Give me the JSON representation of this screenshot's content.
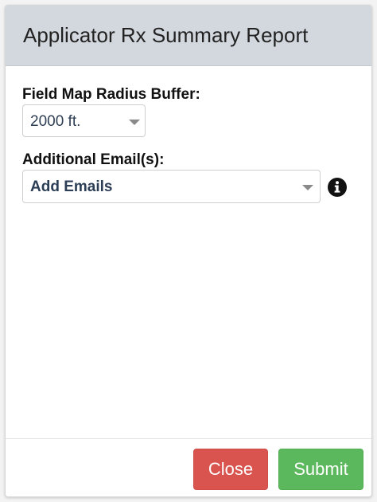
{
  "modal": {
    "title": "Applicator Rx Summary Report"
  },
  "form": {
    "radius_label": "Field Map Radius Buffer:",
    "radius_value": "2000 ft.",
    "emails_label": "Additional Email(s):",
    "emails_value": "Add Emails",
    "info_icon": "info-circle-icon"
  },
  "footer": {
    "close_label": "Close",
    "submit_label": "Submit"
  },
  "colors": {
    "header_bg": "#d3d8de",
    "close_button": "#d9534f",
    "submit_button": "#5cb85c",
    "select_text": "#2f3f55"
  }
}
